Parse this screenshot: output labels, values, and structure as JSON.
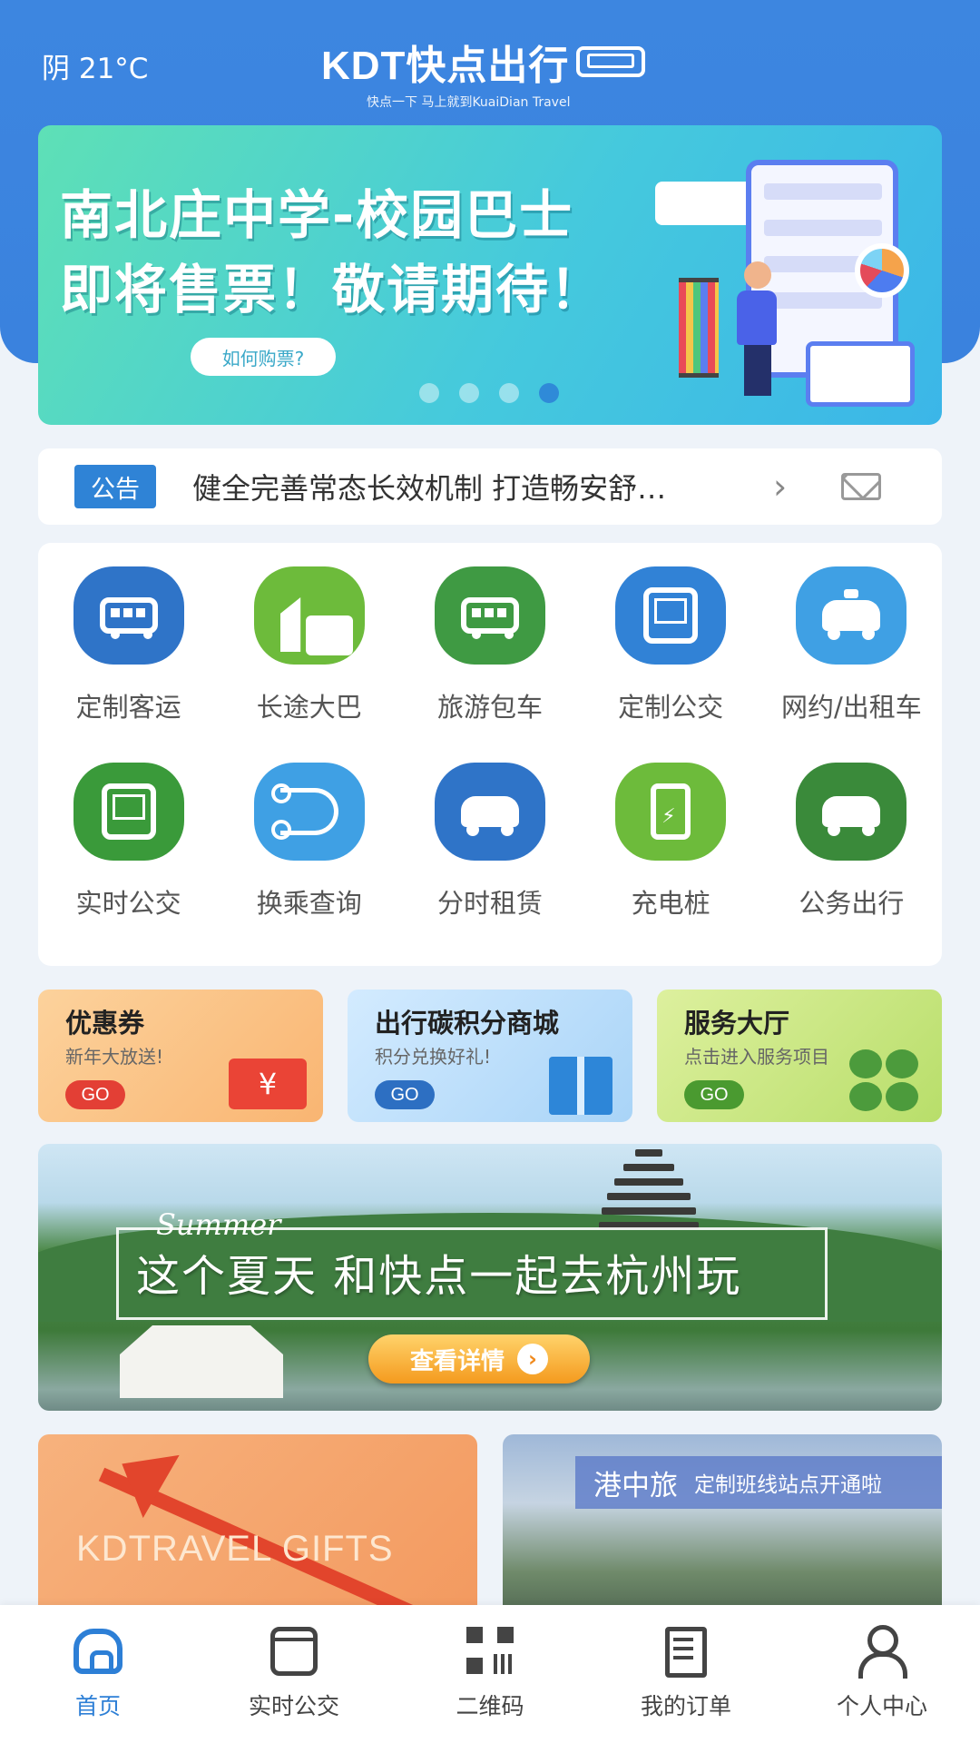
{
  "header": {
    "weather": "阴 21°C",
    "logo_main": "KDT快点出行",
    "logo_sub": "快点一下 马上就到KuaiDian Travel"
  },
  "banner": {
    "line1": "南北庄中学-校园巴士",
    "line2": "即将售票！敬请期待！",
    "button": "如何购票?",
    "dots_total": 4,
    "dots_active_index": 3
  },
  "notice": {
    "tag": "公告",
    "text": "健全完善常态长效机制 打造畅安舒…",
    "chevron_icon": "chevron-right-icon",
    "mail_icon": "mail-icon"
  },
  "services": [
    {
      "label": "定制客运",
      "icon": "bus-icon",
      "color": "#2f74c8"
    },
    {
      "label": "长途大巴",
      "icon": "city-bus-icon",
      "color": "#6dbb3b"
    },
    {
      "label": "旅游包车",
      "icon": "charter-bus-icon",
      "color": "#3f9a43"
    },
    {
      "label": "定制公交",
      "icon": "custom-bus-icon",
      "color": "#3182d6"
    },
    {
      "label": "网约/出租车",
      "icon": "taxi-icon",
      "color": "#3fa0e4"
    },
    {
      "label": "实时公交",
      "icon": "realtime-bus-icon",
      "color": "#3a9a3a"
    },
    {
      "label": "换乘查询",
      "icon": "route-icon",
      "color": "#3fa0e4"
    },
    {
      "label": "分时租赁",
      "icon": "car-rental-icon",
      "color": "#2f74c8"
    },
    {
      "label": "充电桩",
      "icon": "charging-pile-icon",
      "color": "#6dbb3b"
    },
    {
      "label": "公务出行",
      "icon": "car-icon",
      "color": "#3a8a3a"
    }
  ],
  "promos": [
    {
      "title": "优惠券",
      "sub": "新年大放送!",
      "go": "GO",
      "bg": "#fbc78c",
      "go_color": "#e33f35"
    },
    {
      "title": "出行碳积分商城",
      "sub": "积分兑换好礼!",
      "go": "GO",
      "bg": "#bfe0fa",
      "go_color": "#2d6fc2"
    },
    {
      "title": "服务大厅",
      "sub": "点击进入服务项目",
      "go": "GO",
      "bg": "#cde88a",
      "go_color": "#4a9a30"
    }
  ],
  "summer_banner": {
    "script": "Summer",
    "text": "这个夏天 和快点一起去杭州玩",
    "button": "查看详情"
  },
  "cards": {
    "left_text": "KDTRAVEL GIFTS",
    "right_big": "港中旅",
    "right_small": "定制班线站点开通啦"
  },
  "tabbar": [
    {
      "label": "首页",
      "icon": "home-icon",
      "active": true
    },
    {
      "label": "实时公交",
      "icon": "bus-icon",
      "active": false
    },
    {
      "label": "二维码",
      "icon": "qr-code-icon",
      "active": false
    },
    {
      "label": "我的订单",
      "icon": "order-icon",
      "active": false
    },
    {
      "label": "个人中心",
      "icon": "user-icon",
      "active": false
    }
  ],
  "colors": {
    "header_blue": "#3d86e0",
    "accent_blue": "#2d7fd6",
    "page_bg": "#eef3f9"
  }
}
